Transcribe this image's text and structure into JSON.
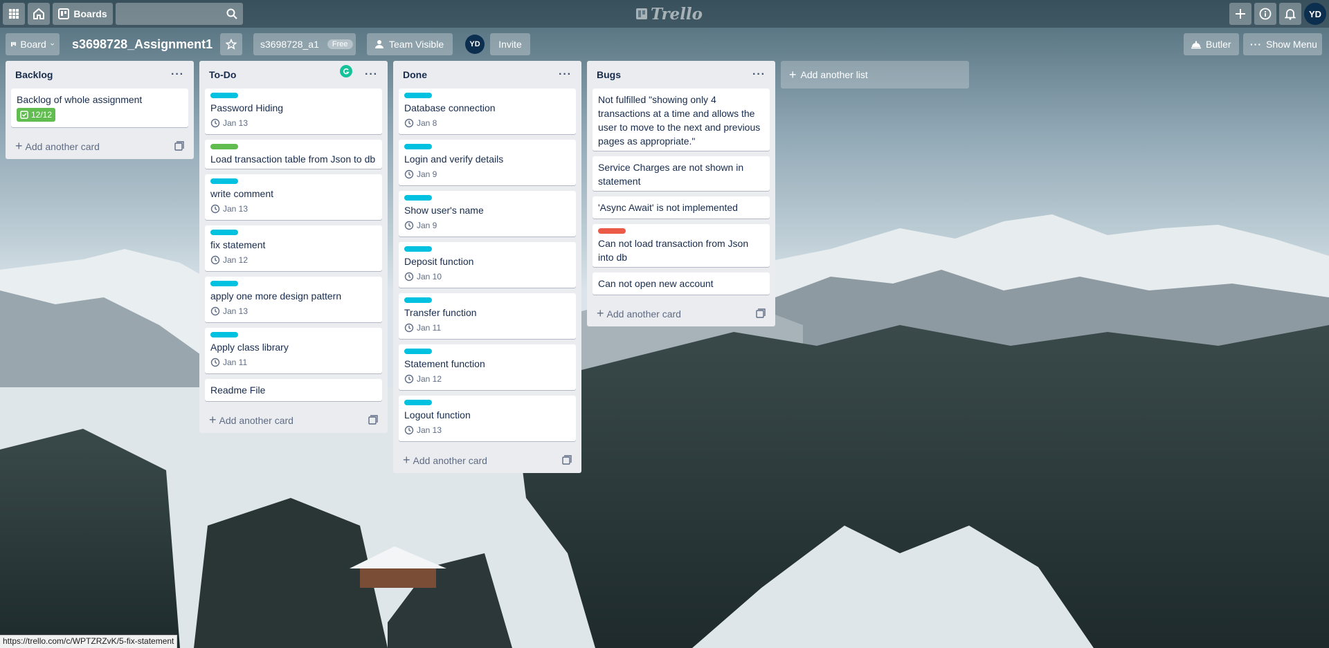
{
  "header": {
    "boards_label": "Boards",
    "logo_text": "Trello",
    "user_initials": "YD"
  },
  "board": {
    "view_label": "Board",
    "name": "s3698728_Assignment1",
    "team_name": "s3698728_a1",
    "team_plan": "Free",
    "visibility": "Team Visible",
    "member_initials": "YD",
    "invite_label": "Invite",
    "butler_label": "Butler",
    "show_menu_label": "Show Menu"
  },
  "lists": [
    {
      "title": "Backlog",
      "cards": [
        {
          "title": "Backlog of whole assignment",
          "checklist": "12/12"
        }
      ],
      "add_card_label": "Add another card"
    },
    {
      "title": "To-Do",
      "cards": [
        {
          "title": "Password Hiding",
          "label_color": "#00c2e0",
          "due": "Jan 13"
        },
        {
          "title": "Load transaction table from Json to db",
          "label_color": "#61bd4f"
        },
        {
          "title": "write comment",
          "label_color": "#00c2e0",
          "due": "Jan 13"
        },
        {
          "title": "fix statement",
          "label_color": "#00c2e0",
          "due": "Jan 12"
        },
        {
          "title": "apply one more design pattern",
          "label_color": "#00c2e0",
          "due": "Jan 13"
        },
        {
          "title": "Apply class library",
          "label_color": "#00c2e0",
          "due": "Jan 11"
        },
        {
          "title": "Readme File"
        }
      ],
      "add_card_label": "Add another card"
    },
    {
      "title": "Done",
      "cards": [
        {
          "title": "Database connection",
          "label_color": "#00c2e0",
          "due": "Jan 8"
        },
        {
          "title": "Login and verify details",
          "label_color": "#00c2e0",
          "due": "Jan 9"
        },
        {
          "title": "Show user's name",
          "label_color": "#00c2e0",
          "due": "Jan 9"
        },
        {
          "title": "Deposit function",
          "label_color": "#00c2e0",
          "due": "Jan 10"
        },
        {
          "title": "Transfer function",
          "label_color": "#00c2e0",
          "due": "Jan 11"
        },
        {
          "title": "Statement function",
          "label_color": "#00c2e0",
          "due": "Jan 12"
        },
        {
          "title": "Logout function",
          "label_color": "#00c2e0",
          "due": "Jan 13"
        }
      ],
      "add_card_label": "Add another card"
    },
    {
      "title": "Bugs",
      "cards": [
        {
          "title": "Not fulfilled \"showing only 4 transactions at a time and allows the user to move to the next and previous pages as appropriate.\""
        },
        {
          "title": "Service Charges are not shown in statement"
        },
        {
          "title": "'Async Await' is not implemented"
        },
        {
          "title": "Can not load transaction from Json into db",
          "label_color": "#eb5a46"
        },
        {
          "title": "Can not open new account"
        }
      ],
      "add_card_label": "Add another card"
    }
  ],
  "add_list_label": "Add another list",
  "status_url": "https://trello.com/c/WPTZRZvK/5-fix-statement",
  "colors": {
    "cyan_label": "#00c2e0",
    "green_label": "#61bd4f",
    "red_label": "#eb5a46",
    "list_bg": "#ebecf0"
  }
}
